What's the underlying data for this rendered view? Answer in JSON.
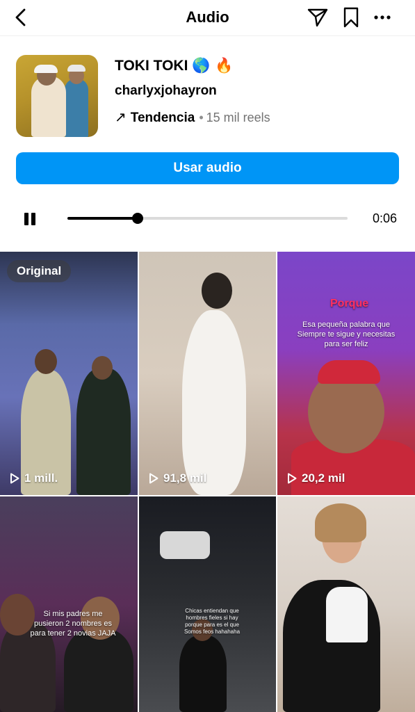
{
  "header": {
    "title": "Audio"
  },
  "audio": {
    "title": "TOKI TOKI",
    "title_emojis": "🌎 🔥",
    "artist": "charlyxjohayron",
    "trend_arrow": "↗",
    "trend_label": "Tendencia",
    "separator": "•",
    "reels_count": "15 mil reels",
    "use_button": "Usar audio"
  },
  "player": {
    "time": "0:06",
    "progress": 0.25,
    "state": "playing"
  },
  "reels": [
    {
      "views": "1 mill.",
      "badge": "Original"
    },
    {
      "views": "91,8 mil"
    },
    {
      "views": "20,2 mil",
      "caption_title": "Porque",
      "caption": "Esa pequeña palabra que Siempre te sigue y necesitas para ser feliz"
    },
    {
      "caption": "Si mis padres me pusieron 2 nombres es para tener 2 novias JAJA"
    },
    {
      "caption": "Chicas entiendan que hombres fieles si hay porque para es el que Somos feos hahahaha"
    },
    {}
  ],
  "colors": {
    "accent": "#0095f6",
    "text": "#000000",
    "secondary": "#737373"
  }
}
